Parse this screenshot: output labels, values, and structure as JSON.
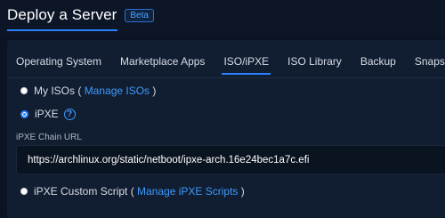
{
  "header": {
    "title": "Deploy a Server",
    "badge": "Beta"
  },
  "tabs": [
    {
      "label": "Operating System",
      "active": false
    },
    {
      "label": "Marketplace Apps",
      "active": false
    },
    {
      "label": "ISO/iPXE",
      "active": true
    },
    {
      "label": "ISO Library",
      "active": false
    },
    {
      "label": "Backup",
      "active": false
    },
    {
      "label": "Snapshot",
      "active": false
    }
  ],
  "options": {
    "my_isos": {
      "label": "My ISOs (",
      "link": "Manage ISOs",
      "suffix": ")",
      "checked": false
    },
    "ipxe": {
      "label": "iPXE",
      "help_icon": "question-circle-icon",
      "checked": true
    },
    "custom_script": {
      "label": "iPXE Custom Script (",
      "link": "Manage iPXE Scripts",
      "suffix": ")",
      "checked": false
    }
  },
  "chain_url": {
    "label": "iPXE Chain URL",
    "value": "https://archlinux.org/static/netboot/ipxe-arch.16e24bec1a7c.efi"
  },
  "colors": {
    "accent": "#2a7fff",
    "link": "#3d9bff",
    "background": "#0b1424",
    "panel": "#111d30"
  }
}
